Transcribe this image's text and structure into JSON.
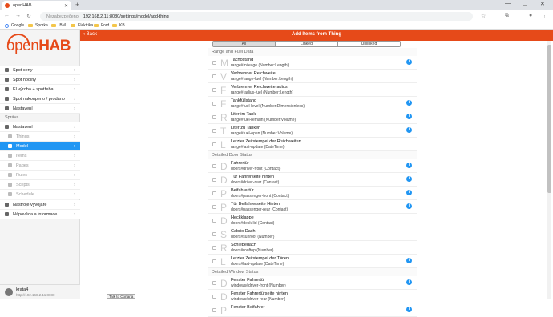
{
  "browser": {
    "tab_title": "openHAB",
    "security": "Nezabezpečeno",
    "url": "192.168.2.11:8080/settings/model/add-thing"
  },
  "bookmarks": [
    "Google",
    "Sporka",
    "IBM",
    "Elektrika",
    "Ford",
    "KB"
  ],
  "app": {
    "logo_open": "open",
    "logo_hab": "HAB",
    "header_title": "Add Items from Thing",
    "back_label": "Back"
  },
  "sidebar": {
    "top_items": [
      {
        "label": "Spot ceny"
      },
      {
        "label": "Spot hodiny"
      },
      {
        "label": "El výroba + spotřeba"
      },
      {
        "label": "Spot nakoupeno / prodáno"
      },
      {
        "label": "Nastavení"
      }
    ],
    "section_label": "Správa",
    "admin_items": [
      {
        "label": "Nastavení",
        "sub": false,
        "active": false
      },
      {
        "label": "Things",
        "sub": true,
        "active": false
      },
      {
        "label": "Model",
        "sub": true,
        "active": true
      },
      {
        "label": "Items",
        "sub": true,
        "active": false
      },
      {
        "label": "Pages",
        "sub": true,
        "active": false
      },
      {
        "label": "Rules",
        "sub": true,
        "active": false
      },
      {
        "label": "Scripts",
        "sub": true,
        "active": false
      },
      {
        "label": "Schedule",
        "sub": true,
        "active": false
      }
    ],
    "bottom_items": [
      {
        "label": "Nástroje vývojáře"
      },
      {
        "label": "Nápověda a informace"
      }
    ],
    "user_name": "krata4",
    "user_url": "http://192.168.2.11:8080"
  },
  "tooltip": "Talk to Cortana",
  "segments": [
    "All",
    "Linked",
    "Unlinked"
  ],
  "list": [
    {
      "type": "section",
      "label": "Range and Fuel Data"
    },
    {
      "type": "item",
      "letter": "M",
      "title": "Tachostand",
      "sub": "range#mileage (Number:Length)",
      "info": true
    },
    {
      "type": "item",
      "letter": "V",
      "title": "Verbrenner Reichweite",
      "sub": "range#range-fuel (Number:Length)",
      "info": false
    },
    {
      "type": "item",
      "letter": "F",
      "title": "Verbrenner Reichweiteradius",
      "sub": "range#radius-fuel (Number:Length)",
      "info": false
    },
    {
      "type": "item",
      "letter": "F",
      "title": "Tankfüllstand",
      "sub": "range#fuel-level (Number:Dimensionless)",
      "info": true
    },
    {
      "type": "item",
      "letter": "R",
      "title": "Liter im Tank",
      "sub": "range#fuel-remain (Number:Volume)",
      "info": true
    },
    {
      "type": "item",
      "letter": "T",
      "title": "Liter zu Tanken",
      "sub": "range#fuel-open (Number:Volume)",
      "info": true
    },
    {
      "type": "item",
      "letter": "L",
      "title": "Letzter Zeitstempel der Reichweiten",
      "sub": "range#last-update (DateTime)",
      "info": false
    },
    {
      "type": "section",
      "label": "Detailed Door Status"
    },
    {
      "type": "item",
      "letter": "D",
      "title": "Fahrertür",
      "sub": "doors#driver-front (Contact)",
      "info": true
    },
    {
      "type": "item",
      "letter": "D",
      "title": "Tür Fahrerseite hinten",
      "sub": "doors#driver-rear (Contact)",
      "info": true
    },
    {
      "type": "item",
      "letter": "P",
      "title": "Beifahrertür",
      "sub": "doors#passenger-front (Contact)",
      "info": true
    },
    {
      "type": "item",
      "letter": "P",
      "title": "Tür Beifahrerseite Hinten",
      "sub": "doors#passenger-rear (Contact)",
      "info": true
    },
    {
      "type": "item",
      "letter": "D",
      "title": "Heckklappe",
      "sub": "doors#deck-lid (Contact)",
      "info": false
    },
    {
      "type": "item",
      "letter": "S",
      "title": "Cabrio Dach",
      "sub": "doors#sunroof (Number)",
      "info": false
    },
    {
      "type": "item",
      "letter": "R",
      "title": "Schiebedach",
      "sub": "doors#rooftop (Number)",
      "info": false
    },
    {
      "type": "item",
      "letter": "L",
      "title": "Letzter Zeitstempel der Türen",
      "sub": "doors#last-update (DateTime)",
      "info": true
    },
    {
      "type": "section",
      "label": "Detailed Window Status"
    },
    {
      "type": "item",
      "letter": "D",
      "title": "Fenster Fahrertür",
      "sub": "windows#driver-front (Number)",
      "info": true
    },
    {
      "type": "item",
      "letter": "D",
      "title": "Fenster Fahrertürseite hinten",
      "sub": "windows#driver-rear (Number)",
      "info": false
    },
    {
      "type": "item",
      "letter": "P",
      "title": "Fenster Beifahrer",
      "sub": "",
      "info": true
    }
  ],
  "colors": {
    "accent": "#e64a19",
    "active": "#2196f3"
  }
}
